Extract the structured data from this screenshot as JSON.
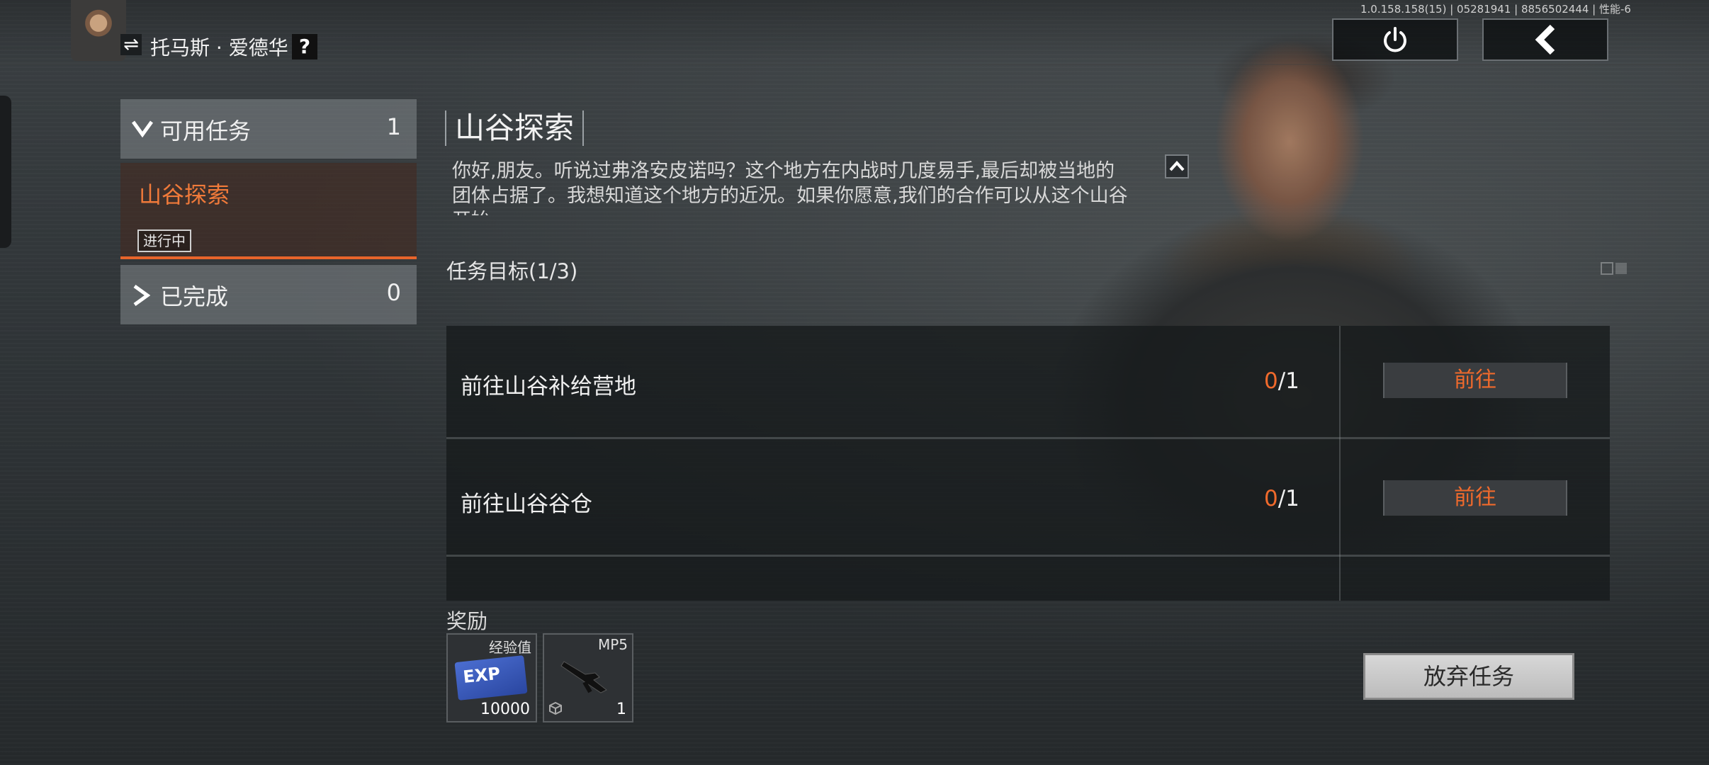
{
  "header": {
    "npc_name": "托马斯 · 爱德华",
    "help_label": "?",
    "swap_icon": "swap-icon",
    "version_text": "1.0.158.158(15) | 05281941 | 8856502444 | 性能-6",
    "power_icon": "power-icon",
    "back_icon": "back-arrow-icon"
  },
  "sidebar": {
    "available": {
      "label": "可用任务",
      "count": "1"
    },
    "quest": {
      "name": "山谷探索",
      "status": "进行中"
    },
    "completed": {
      "label": "已完成",
      "count": "0"
    }
  },
  "quest": {
    "title": "山谷探索",
    "description": "你好,朋友。听说过弗洛安皮诺吗？这个地方在内战时几度易手,最后却被当地的团体占据了。我想知道这个地方的近况。如果你愿意,我们的合作可以从这个山谷开始",
    "objectives_title": "任务目标(1/3)",
    "objectives": [
      {
        "name": "前往山谷补给营地",
        "current": "0",
        "total": "/1",
        "action": "前往"
      },
      {
        "name": "前往山谷谷仓",
        "current": "0",
        "total": "/1",
        "action": "前往"
      }
    ],
    "rewards_label": "奖励",
    "rewards": [
      {
        "name": "经验值",
        "qty": "10000",
        "icon_text": "EXP"
      },
      {
        "name": "MP5",
        "qty": "1"
      }
    ],
    "abandon_label": "放弃任务"
  },
  "colors": {
    "accent": "#f06a2c",
    "panel": "#16191b"
  }
}
